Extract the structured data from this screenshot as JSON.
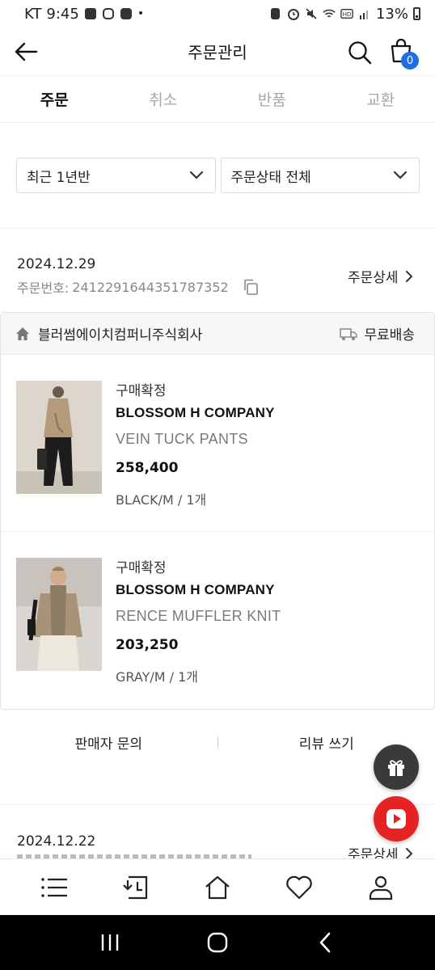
{
  "status_bar": {
    "carrier": "KT",
    "time": "9:45",
    "dot": "•",
    "battery": "13%",
    "left_icons": [
      "image-icon",
      "instagram-icon",
      "alert-icon"
    ],
    "right_icons": [
      "battery-saver-icon",
      "alarm-icon",
      "mute-icon",
      "wifi-icon",
      "hd-icon",
      "signal-icon"
    ]
  },
  "header": {
    "title": "주문관리",
    "cart_count": "0"
  },
  "tabs": [
    {
      "label": "주문",
      "active": true
    },
    {
      "label": "취소",
      "active": false
    },
    {
      "label": "반품",
      "active": false
    },
    {
      "label": "교환",
      "active": false
    }
  ],
  "filters": {
    "period": "최근 1년반",
    "status": "주문상태 전체"
  },
  "orders": [
    {
      "date": "2024.12.29",
      "number_label": "주문번호:",
      "number": "2412291644351787352",
      "detail_label": "주문상세",
      "shop": {
        "name": "블러썸에이치컴퍼니주식회사",
        "shipping": "무료배송"
      },
      "products": [
        {
          "status": "구매확정",
          "brand": "BLOSSOM H COMPANY",
          "name": "VEIN TUCK PANTS",
          "price": "258,400",
          "option": "BLACK/M / 1개"
        },
        {
          "status": "구매확정",
          "brand": "BLOSSOM H COMPANY",
          "name": "RENCE MUFFLER KNIT",
          "price": "203,250",
          "option": "GRAY/M / 1개"
        }
      ],
      "actions": [
        "판매자 문의",
        "리뷰 쓰기"
      ]
    },
    {
      "date": "2024.12.22",
      "detail_label": "주문상세"
    }
  ],
  "bottom_nav": [
    "menu-icon",
    "recent-icon",
    "home-icon",
    "heart-icon",
    "profile-icon"
  ],
  "colors": {
    "badge_blue": "#1e6ee6",
    "play_red": "#e62222",
    "gift_dark": "#3a3a3a"
  }
}
